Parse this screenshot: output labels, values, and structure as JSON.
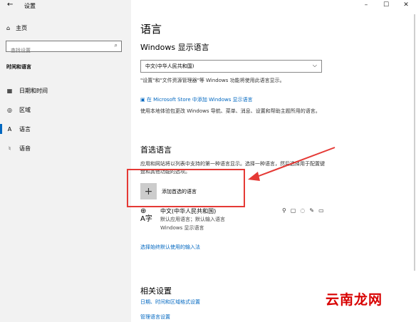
{
  "window": {
    "title": "设置",
    "controls": [
      "–",
      "☐",
      "✕"
    ]
  },
  "sidebar": {
    "home_label": "主页",
    "search_placeholder": "查找设置",
    "section_title": "时间和语言",
    "items": [
      {
        "label": "日期和时间",
        "icon": "calendar-icon"
      },
      {
        "label": "区域",
        "icon": "globe-icon"
      },
      {
        "label": "语言",
        "icon": "language-icon",
        "active": true
      },
      {
        "label": "语音",
        "icon": "microphone-icon"
      }
    ]
  },
  "main": {
    "title": "语言",
    "display_language": {
      "heading": "Windows 显示语言",
      "selected": "中文(中华人民共和国)",
      "desc": "\"设置\"和\"文件资源管理器\"等 Windows 功能将使用此语言显示。",
      "store_link": "在 Microsoft Store 中添加 Windows 显示语言",
      "store_desc": "使用本地体验包更改 Windows 导航、菜单、消息、设置和帮助主题所用的语言。"
    },
    "preferred": {
      "heading": "首选语言",
      "desc": "应用和网站将以列表中支持的第一种语言显示。选择一种语言，然后选择用于配置键盘和其他功能的选项。",
      "add_label": "添加首选的语言",
      "language": {
        "name": "中文(中华人民共和国)",
        "sub1": "默认应用语言；默认输入语言",
        "sub2": "Windows 显示语言"
      },
      "input_link": "选择始终默认使用的输入法"
    },
    "related": {
      "heading": "相关设置",
      "link1": "日期、时间和区域格式设置",
      "link2": "管理语言设置"
    }
  },
  "annotation": {
    "color": "#e53935"
  },
  "watermark": "云南龙网"
}
